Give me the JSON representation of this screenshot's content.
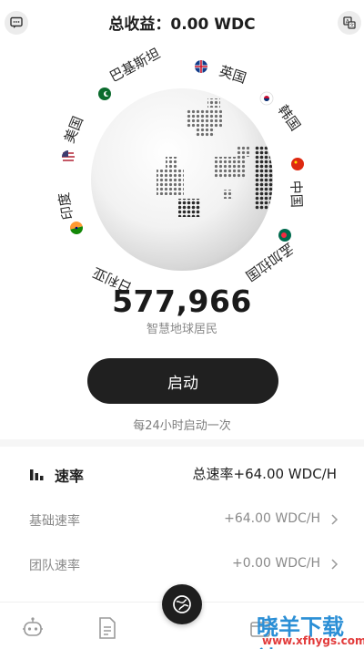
{
  "header": {
    "title": "总收益：0.00 WDC",
    "left_icon": "chat-icon",
    "right_icon": "translate-icon"
  },
  "globe": {
    "countries": [
      {
        "name": "巴基斯坦",
        "flag": "pakistan-flag-icon"
      },
      {
        "name": "英国",
        "flag": "uk-flag-icon"
      },
      {
        "name": "韩国",
        "flag": "korea-flag-icon"
      },
      {
        "name": "中国",
        "flag": "china-flag-icon"
      },
      {
        "name": "孟加拉国",
        "flag": "bangladesh-flag-icon"
      },
      {
        "name": "印度",
        "flag": "india-flag-icon"
      },
      {
        "name": "美国",
        "flag": "usa-flag-icon"
      },
      {
        "name": "日利亚",
        "flag": "nigeria-flag-icon"
      }
    ]
  },
  "stats": {
    "count": "577,966",
    "count_label": "智慧地球居民"
  },
  "action": {
    "start_label": "启动",
    "note": "每24小时启动一次"
  },
  "rates": {
    "title": "速率",
    "total": "总速率+64.00 WDC/H",
    "rows": [
      {
        "label": "基础速率",
        "value": "+64.00 WDC/H"
      },
      {
        "label": "团队速率",
        "value": "+0.00 WDC/H"
      }
    ]
  },
  "nav": {
    "items": [
      "robot-icon",
      "document-icon",
      "globe-icon",
      "wallet-icon"
    ]
  },
  "watermark": {
    "text": "晓羊下载站",
    "url": "www.xfhygs.com"
  },
  "colors": {
    "button_bg": "#202020",
    "china_flag": "#de2910",
    "watermark_blue": "#2b8fd6",
    "watermark_red": "#e23b3b"
  }
}
